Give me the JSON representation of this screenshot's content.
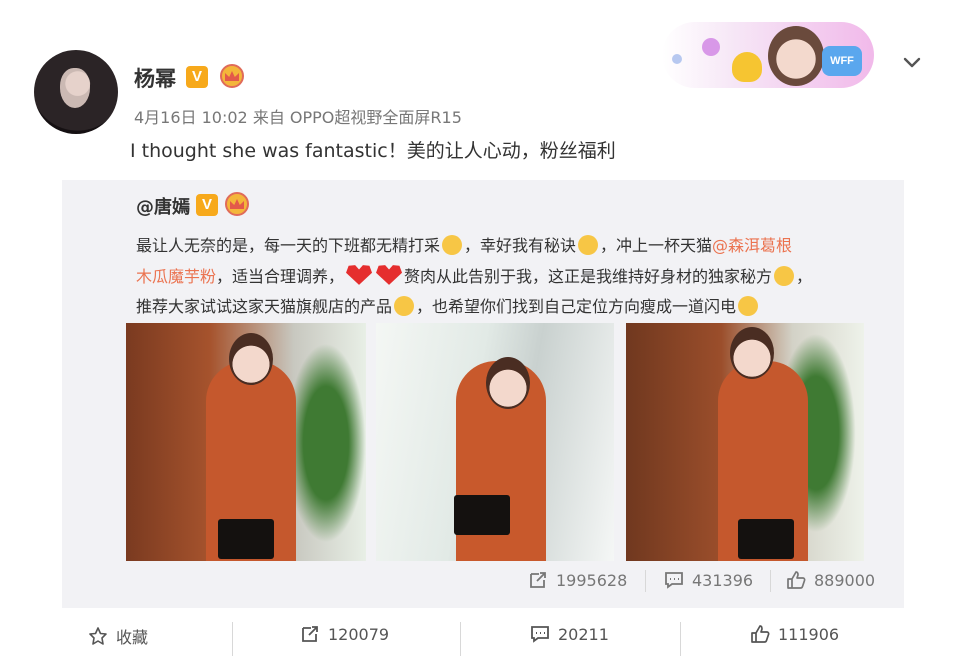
{
  "post": {
    "author": "杨幂",
    "meta": "4月16日 10:02 来自 OPPO超视野全面屏R15",
    "text": "I thought she was fantastic！美的让人心动，粉丝福利"
  },
  "banner": {
    "logo_text": "WFF"
  },
  "repost": {
    "author": "@唐嫣",
    "line1_a": "最让人无奈的是，每一天的下班都无精打采",
    "line1_b": "，幸好我有秘诀",
    "line1_c": "，冲上一杯天猫",
    "line1_link": "@森洱葛根",
    "line2_link": "木瓜魔芋粉",
    "line2_a": "，适当合理调养，",
    "line2_b": "赘肉从此告别于我，这正是我维持好身材的独家秘方",
    "line2_c": "，",
    "line3_a": "推荐大家试试这家天猫旗舰店的产品",
    "line3_b": "，也希望你们找到自己定位方向瘦成一道闪电",
    "actions": {
      "repost_count": "1995628",
      "comment_count": "431396",
      "like_count": "889000"
    }
  },
  "footer": {
    "favorite_label": "收藏",
    "repost_count": "120079",
    "comment_count": "20211",
    "like_count": "111906"
  },
  "colors": {
    "link": "#eb7350",
    "vip_badge": "#f7a91b",
    "repost_bg": "#f2f2f5"
  },
  "icons": [
    "vip-v-icon",
    "crown-icon",
    "chevron-down-icon",
    "repost-icon",
    "comment-icon",
    "like-icon",
    "star-icon"
  ]
}
